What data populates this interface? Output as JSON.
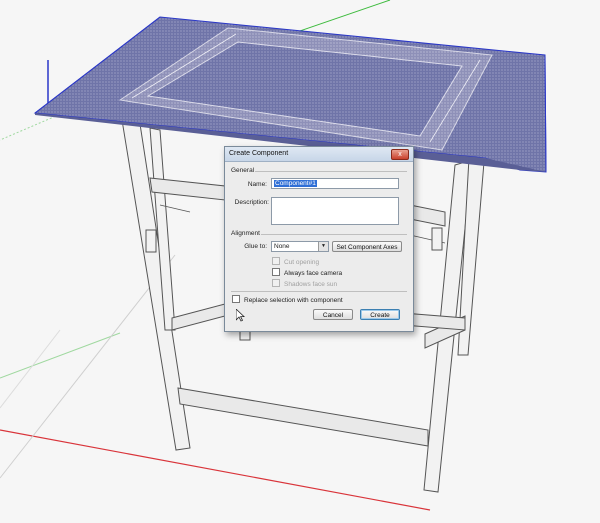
{
  "dialog": {
    "title": "Create Component",
    "close_glyph": "x",
    "general": {
      "heading": "General",
      "name_label": "Name:",
      "name_value": "Component#1",
      "description_label": "Description:",
      "description_value": ""
    },
    "alignment": {
      "heading": "Alignment",
      "glue_label": "Glue to:",
      "glue_value": "None",
      "set_axes_label": "Set Component Axes",
      "cut_opening_label": "Cut opening",
      "always_face_camera_label": "Always face camera",
      "shadows_face_sun_label": "Shadows face sun"
    },
    "replace_selection_label": "Replace selection with component",
    "cancel_label": "Cancel",
    "create_label": "Create"
  },
  "scene": {
    "icons": [
      "axis-origin-icon",
      "mouse-pointer-icon"
    ],
    "colors": {
      "red_axis": "#d9343a",
      "green_axis": "#3dbb3d",
      "blue_axis": "#2a37c8",
      "selection_plane": "#6f74a8",
      "selection_edge": "#2a37c8"
    }
  }
}
